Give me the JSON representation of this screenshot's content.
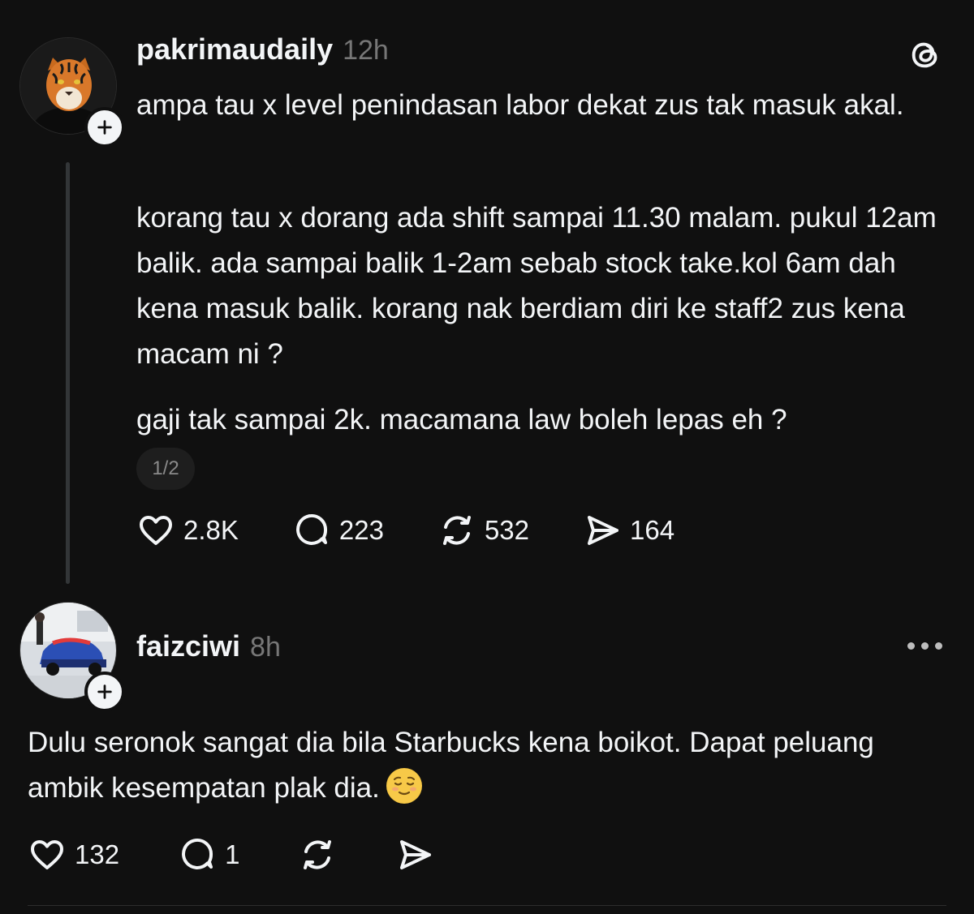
{
  "post1": {
    "username": "pakrimaudaily",
    "time": "12h",
    "paragraphs": [
      "ampa tau x level penindasan labor dekat zus tak masuk akal.",
      "korang tau x dorang ada shift sampai 11.30 malam. pukul 12am balik. ada sampai balik 1-2am sebab stock take.kol 6am dah kena masuk balik. korang nak berdiam diri ke staff2 zus kena macam ni ?",
      "gaji tak sampai 2k. macamana law boleh lepas eh ?"
    ],
    "pager": "1/2",
    "likes": "2.8K",
    "replies": "223",
    "reposts": "532",
    "shares": "164"
  },
  "post2": {
    "username": "faizciwi",
    "time": "8h",
    "text": "Dulu seronok sangat dia bila Starbucks kena boikot. Dapat peluang ambik kesempatan plak dia.",
    "likes": "132",
    "replies": "1"
  },
  "icons": {
    "like": "heart-icon",
    "reply": "comment-icon",
    "repost": "repost-icon",
    "share": "send-icon",
    "follow": "plus-icon",
    "app": "threads-logo-icon",
    "more": "more-icon",
    "emoji": "relieved-face-emoji"
  },
  "colors": {
    "background": "#101010",
    "text": "#f3f5f7",
    "muted": "#777777"
  }
}
